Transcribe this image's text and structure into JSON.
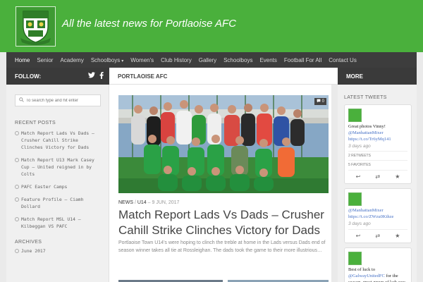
{
  "header": {
    "tagline": "All the latest news for Portlaoise AFC",
    "logo_text_top": "PORTLAOISE A.F.C.",
    "logo_text_bottom": "FOUNDED 1971"
  },
  "nav": {
    "items": [
      {
        "label": "Home",
        "active": true
      },
      {
        "label": "Senior"
      },
      {
        "label": "Academy"
      },
      {
        "label": "Schoolboys",
        "dropdown": true
      },
      {
        "label": "Women's"
      },
      {
        "label": "Club History"
      },
      {
        "label": "Gallery"
      },
      {
        "label": "Schoolboys"
      },
      {
        "label": "Events"
      },
      {
        "label": "Football For All"
      },
      {
        "label": "Contact Us"
      }
    ]
  },
  "left_bar": {
    "follow_label": "FOLLOW:"
  },
  "main_bar": {
    "section_title": "PORTLAOISE AFC"
  },
  "right_bar": {
    "more_label": "MORE"
  },
  "left_sidebar": {
    "search_placeholder": "To search type and hit enter",
    "recent_posts_title": "RECENT POSTS",
    "recent_posts": [
      "Match Report Lads Vs Dads – Crusher Cahill Strike Clinches Victory for Dads",
      "Match Report U13 Mark Casey Cup – United reigned in by Colts",
      "PAFC Easter Camps",
      "Feature Profile – Ciamh Dollard",
      "Match Report MSL U14 – Kilbeggan VS PAFC"
    ],
    "archives_title": "ARCHIVES",
    "archives": [
      "June 2017"
    ]
  },
  "main": {
    "comment_count": "0",
    "category_1": "NEWS",
    "category_2": "U14",
    "date": "9 JUN, 2017",
    "post_title": "Match Report Lads Vs Dads – Crusher Cahill Strike Clinches Victory for Dads",
    "excerpt": "Portlaoise Town U14's were hoping to clinch the treble at home in the Lads versus Dads end of season winner takes all tie at Rossleighan. The dads took the game to their more illustrious…"
  },
  "right_sidebar": {
    "title": "LATEST TWEETS",
    "tweets": [
      {
        "text": "Great photos Vinny! ",
        "link1": "@ManhattanMixer",
        "link2": "https://t.co/Tr6yMq141",
        "age": "3 days ago",
        "retweets": "2 RETWEETS",
        "favorites": "5 FAVORITES"
      },
      {
        "text": "",
        "link1": "@ManhattanMixer",
        "link2": "https://t.co/ZWzu0Kthze",
        "age": "3 days ago"
      },
      {
        "text": "Best of luck to ",
        "link1": "@GalwayUnitedFC",
        "after": " for the season, great group of lads you have there. Best wishes"
      }
    ]
  },
  "colors": {
    "brand_green": "#4ab03c",
    "nav_dark": "#3d3d3d",
    "link_blue": "#4671c6"
  }
}
